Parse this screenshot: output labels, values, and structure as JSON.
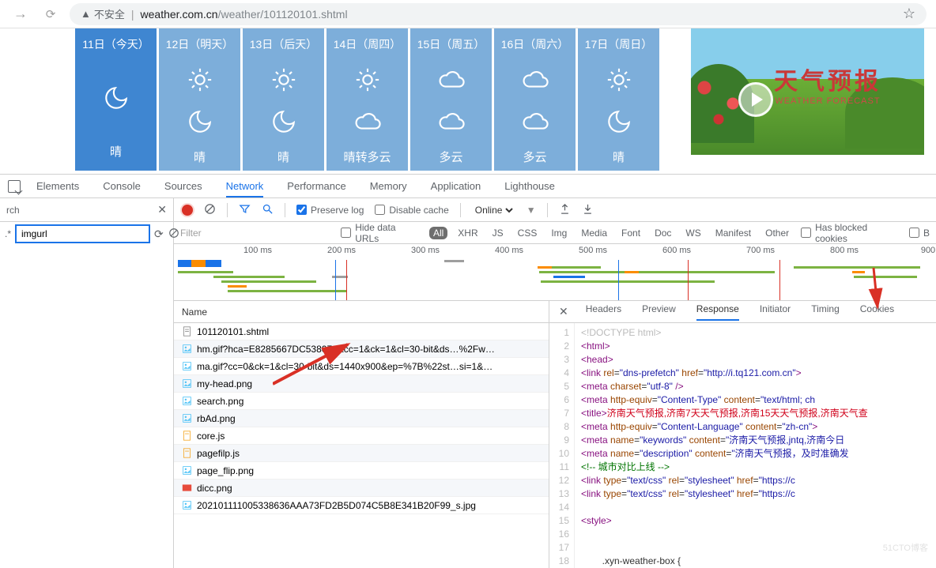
{
  "browser": {
    "not_secure": "不安全",
    "url_host": "weather.com.cn",
    "url_path": "/weather/101120101.shtml"
  },
  "weather_cards": [
    {
      "date": "11日（今天）",
      "type": "today",
      "icons": [
        "moon"
      ],
      "desc": "晴"
    },
    {
      "date": "12日（明天）",
      "type": "future",
      "icons": [
        "sun",
        "moon"
      ],
      "desc": "晴"
    },
    {
      "date": "13日（后天）",
      "type": "future",
      "icons": [
        "sun",
        "moon"
      ],
      "desc": "晴"
    },
    {
      "date": "14日（周四）",
      "type": "future",
      "icons": [
        "sun",
        "cloud"
      ],
      "desc": "晴转多云"
    },
    {
      "date": "15日（周五）",
      "type": "future",
      "icons": [
        "cloud",
        "cloud"
      ],
      "desc": "多云"
    },
    {
      "date": "16日（周六）",
      "type": "future",
      "icons": [
        "cloud",
        "cloud"
      ],
      "desc": "多云"
    },
    {
      "date": "17日（周日）",
      "type": "future",
      "icons": [
        "sun",
        "moon"
      ],
      "desc": "晴"
    }
  ],
  "banner": {
    "cn": "天气预报",
    "en": "WEATHER FORECAST"
  },
  "devtools": {
    "tabs": [
      "Elements",
      "Console",
      "Sources",
      "Network",
      "Performance",
      "Memory",
      "Application",
      "Lighthouse"
    ],
    "active_tab": "Network",
    "search": {
      "label": "rch",
      "mode": ".*",
      "value": "imgurl"
    },
    "toolbar": {
      "preserve_log": "Preserve log",
      "disable_cache": "Disable cache",
      "throttling": "Online"
    },
    "filter": {
      "placeholder": "Filter",
      "hide_data_urls": "Hide data URLs",
      "types": [
        "All",
        "XHR",
        "JS",
        "CSS",
        "Img",
        "Media",
        "Font",
        "Doc",
        "WS",
        "Manifest",
        "Other"
      ],
      "active_type": "All",
      "blocked_cookies": "Has blocked cookies",
      "blocked_b": "B"
    },
    "timeline_ticks": [
      "100 ms",
      "200 ms",
      "300 ms",
      "400 ms",
      "500 ms",
      "600 ms",
      "700 ms",
      "800 ms",
      "900"
    ],
    "name_header": "Name",
    "requests": [
      {
        "ico": "doc",
        "label": "101120101.shtml"
      },
      {
        "ico": "img",
        "label": "hm.gif?hca=E8285667DC538078&cc=1&ck=1&cl=30-bit&ds…%2Fw…"
      },
      {
        "ico": "img",
        "label": "ma.gif?cc=0&ck=1&cl=30-bit&ds=1440x900&ep=%7B%22st…si=1&…"
      },
      {
        "ico": "img",
        "label": "my-head.png"
      },
      {
        "ico": "img",
        "label": "search.png"
      },
      {
        "ico": "img",
        "label": "rbAd.png"
      },
      {
        "ico": "js",
        "label": "core.js"
      },
      {
        "ico": "js",
        "label": "pagefilp.js"
      },
      {
        "ico": "img",
        "label": "page_flip.png"
      },
      {
        "ico": "img2",
        "label": "dicc.png"
      },
      {
        "ico": "img",
        "label": "20210111100533863​6AAA73FD2B5D074C5B8E341B20F99_s.jpg"
      }
    ],
    "detail_tabs": [
      "Headers",
      "Preview",
      "Response",
      "Initiator",
      "Timing",
      "Cookies"
    ],
    "active_detail": "Response",
    "response_lines": [
      {
        "html": "<span class='dim'>&lt;!DOCTYPE html&gt;</span>"
      },
      {
        "html": "<span class='tag'>&lt;html&gt;</span>"
      },
      {
        "html": "<span class='tag'>&lt;head&gt;</span>"
      },
      {
        "html": "<span class='tag'>&lt;link</span> <span class='attr'>rel</span>=<span class='str'>\"dns-prefetch\"</span> <span class='attr'>href</span>=<span class='str'>\"http://i.tq121.com.cn\"</span><span class='tag'>&gt;</span>"
      },
      {
        "html": "<span class='tag'>&lt;meta</span> <span class='attr'>charset</span>=<span class='str'>\"utf-8\"</span> <span class='tag'>/&gt;</span>"
      },
      {
        "html": "<span class='tag'>&lt;meta</span> <span class='attr'>http-equiv</span>=<span class='str'>\"Content-Type\"</span> <span class='attr'>content</span>=<span class='str'>\"text/html; ch</span>"
      },
      {
        "html": "<span class='tag'>&lt;title&gt;</span><span class='text'>济南天气预报,济南7天天气预报,济南15天天气预报,济南天气查</span>"
      },
      {
        "html": "<span class='tag'>&lt;meta</span> <span class='attr'>http-equiv</span>=<span class='str'>\"Content-Language\"</span> <span class='attr'>content</span>=<span class='str'>\"zh-cn\"</span><span class='tag'>&gt;</span>"
      },
      {
        "html": "<span class='tag'>&lt;meta</span> <span class='attr'>name</span>=<span class='str'>\"keywords\"</span> <span class='attr'>content</span>=<span class='str'>\"济南天气预报,jntq,济南今日</span>"
      },
      {
        "html": "<span class='tag'>&lt;meta</span> <span class='attr'>name</span>=<span class='str'>\"description\"</span> <span class='attr'>content</span>=<span class='str'>\"济南天气预报，及时准确发</span>"
      },
      {
        "html": "<span class='comm'>&lt;!-- 城市对比上线 --&gt;</span>"
      },
      {
        "html": "<span class='tag'>&lt;link</span> <span class='attr'>type</span>=<span class='str'>\"text/css\"</span> <span class='attr'>rel</span>=<span class='str'>\"stylesheet\"</span> <span class='attr'>href</span>=<span class='str'>\"https://c</span>"
      },
      {
        "html": "<span class='tag'>&lt;link</span> <span class='attr'>type</span>=<span class='str'>\"text/css\"</span> <span class='attr'>rel</span>=<span class='str'>\"stylesheet\"</span> <span class='attr'>href</span>=<span class='str'>\"https://c</span>"
      },
      {
        "html": ""
      },
      {
        "html": "<span class='tag'>&lt;style&gt;</span>"
      },
      {
        "html": ""
      },
      {
        "html": ""
      },
      {
        "html": "        .xyn-weather-box {"
      }
    ]
  },
  "watermark": "51CTO博客"
}
